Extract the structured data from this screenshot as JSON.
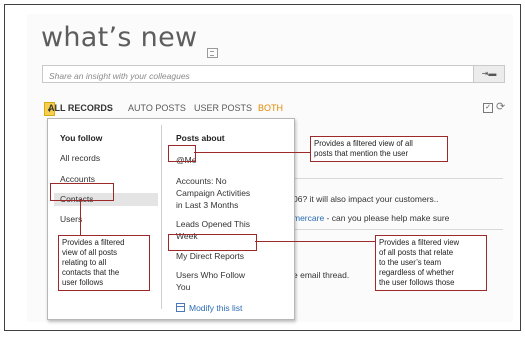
{
  "page": {
    "title": "what’s new",
    "insight_placeholder": "Share an insight with your colleagues"
  },
  "filter_bar": {
    "all_records": "ALL RECORDS",
    "auto_posts": "AUTO POSTS",
    "user_posts": "USER POSTS",
    "both": "BOTH"
  },
  "dropdown": {
    "you_follow": {
      "heading": "You follow",
      "items": [
        "All records",
        "Accounts",
        "Contacts",
        "Users"
      ]
    },
    "posts_about": {
      "heading": "Posts about",
      "items": [
        "@Me",
        "Accounts: No",
        "Campaign Activities",
        "in Last 3 Months",
        "Leads Opened This",
        "Week",
        "My Direct Reports",
        "Users Who Follow",
        "You"
      ],
      "modify_link": "Modify this list"
    }
  },
  "background_feed": {
    "line1": "06? it will also impact your customers..",
    "line2_link": "mercare",
    "line2_rest": " - can you please help make sure",
    "line3": "e email thread."
  },
  "callouts": {
    "mention": [
      "Provides a filtered view of all",
      "posts that mention the user"
    ],
    "contacts": [
      "Provides a filtered",
      "view of all posts",
      "relating to all",
      "contacts that the",
      "user follows"
    ],
    "reports": [
      "Provides a filtered view",
      "of all posts that relate",
      "to the user’s team",
      "regardless of whether",
      "the user follows those"
    ]
  },
  "colors": {
    "accent": "#f7cf4f",
    "both": "#e08a00",
    "callout_border": "#9c2a2a",
    "link": "#2a6cb5"
  },
  "icons": [
    "title-edit-icon",
    "post-icon",
    "chevron-down-icon",
    "checkbox-icon",
    "refresh-icon",
    "modify-list-icon"
  ]
}
